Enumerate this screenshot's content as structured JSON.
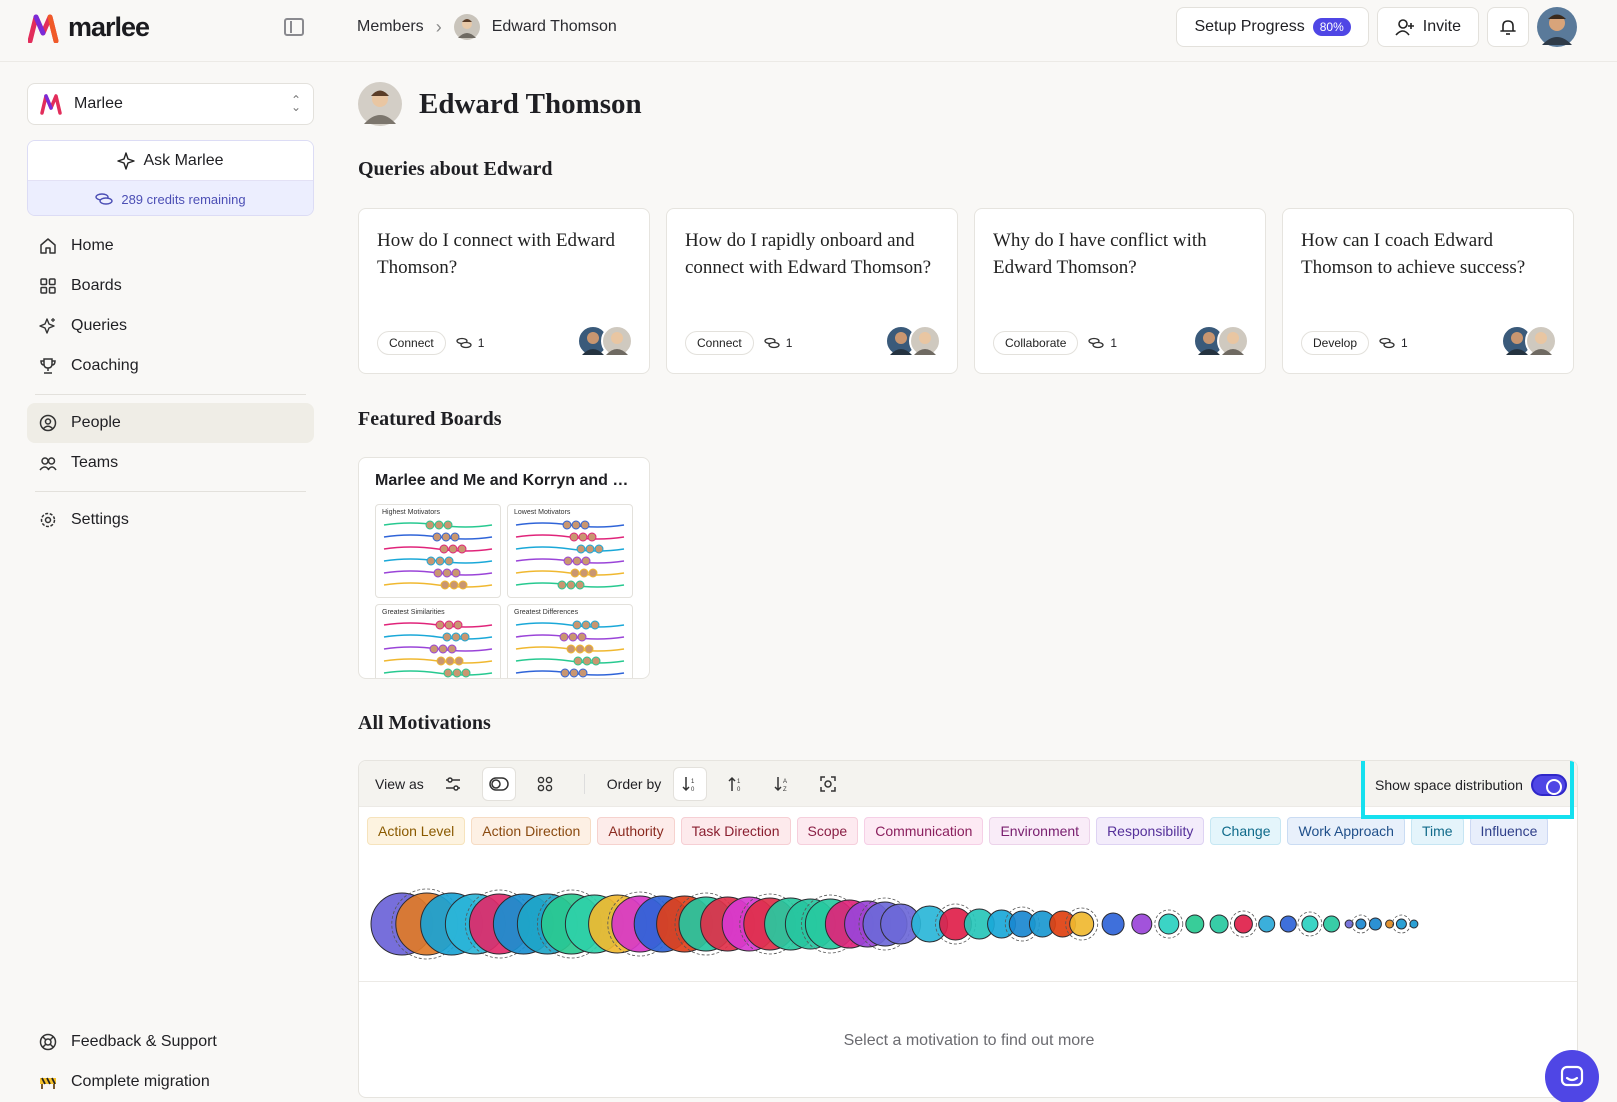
{
  "header": {
    "logo_text": "marlee",
    "breadcrumbs": [
      "Members",
      "Edward Thomson"
    ],
    "setup_label": "Setup Progress",
    "setup_percent": "80%",
    "invite_label": "Invite"
  },
  "sidebar": {
    "org_name": "Marlee",
    "ask_label": "Ask Marlee",
    "credits_text": "289 credits remaining",
    "items": [
      {
        "label": "Home",
        "icon": "home-icon"
      },
      {
        "label": "Boards",
        "icon": "grid-icon"
      },
      {
        "label": "Queries",
        "icon": "sparkle-icon"
      },
      {
        "label": "Coaching",
        "icon": "trophy-icon"
      },
      {
        "label": "People",
        "icon": "person-icon",
        "active": true
      },
      {
        "label": "Teams",
        "icon": "group-icon"
      },
      {
        "label": "Settings",
        "icon": "gear-icon"
      }
    ],
    "bottom_items": [
      {
        "label": "Feedback & Support",
        "icon": "lifebuoy-icon"
      },
      {
        "label": "Complete migration",
        "icon": "barrier-icon"
      }
    ]
  },
  "profile": {
    "name": "Edward Thomson"
  },
  "queries_section": {
    "title": "Queries about Edward",
    "cards": [
      {
        "text": "How do I connect with Edward Thomson?",
        "tag": "Connect",
        "count": "1"
      },
      {
        "text": "How do I rapidly onboard and connect with Edward Thomson?",
        "tag": "Connect",
        "count": "1"
      },
      {
        "text": "Why do I have conflict with Edward Thomson?",
        "tag": "Collaborate",
        "count": "1"
      },
      {
        "text": "How can I coach Edward Thomson to achieve success?",
        "tag": "Develop",
        "count": "1"
      }
    ]
  },
  "boards_section": {
    "title": "Featured Boards",
    "board_title": "Marlee and Me and Korryn and E...",
    "mini_titles": [
      "Highest Motivators",
      "Lowest Motivators",
      "Greatest Similarities",
      "Greatest Differences"
    ]
  },
  "motivations": {
    "title": "All Motivations",
    "view_as_label": "View as",
    "order_by_label": "Order by",
    "space_distribution_label": "Show space distribution",
    "space_distribution_on": true,
    "tags": [
      {
        "label": "Action Level",
        "bg": "#fdf3e0",
        "border": "#f6e3bc",
        "color": "#8a5a00"
      },
      {
        "label": "Action Direction",
        "bg": "#fdf0e4",
        "border": "#f6dcc4",
        "color": "#8a4a10"
      },
      {
        "label": "Authority",
        "bg": "#fdecea",
        "border": "#f6d2ce",
        "color": "#8a2a20"
      },
      {
        "label": "Task Direction",
        "bg": "#fdeaec",
        "border": "#f6cfd4",
        "color": "#8a1f30"
      },
      {
        "label": "Scope",
        "bg": "#fdeaf0",
        "border": "#f6cfdc",
        "color": "#8a1f45"
      },
      {
        "label": "Communication",
        "bg": "#fdeaf4",
        "border": "#f6cfe6",
        "color": "#8a1f5e"
      },
      {
        "label": "Environment",
        "bg": "#f9ecf8",
        "border": "#ecd3ea",
        "color": "#7a2070"
      },
      {
        "label": "Responsibility",
        "bg": "#f3ecfb",
        "border": "#ded3f3",
        "color": "#55309a"
      },
      {
        "label": "Change",
        "bg": "#e4f5fb",
        "border": "#c6e7f3",
        "color": "#0e6a8a"
      },
      {
        "label": "Work Approach",
        "bg": "#e8f0fb",
        "border": "#cadcf3",
        "color": "#1f4f8a"
      },
      {
        "label": "Time",
        "bg": "#e4f4fb",
        "border": "#c6e5f3",
        "color": "#106a8a"
      },
      {
        "label": "Influence",
        "bg": "#e8eefb",
        "border": "#cdd8f3",
        "color": "#2f3f8a"
      }
    ],
    "empty_text": "Select a motivation to find out more"
  }
}
